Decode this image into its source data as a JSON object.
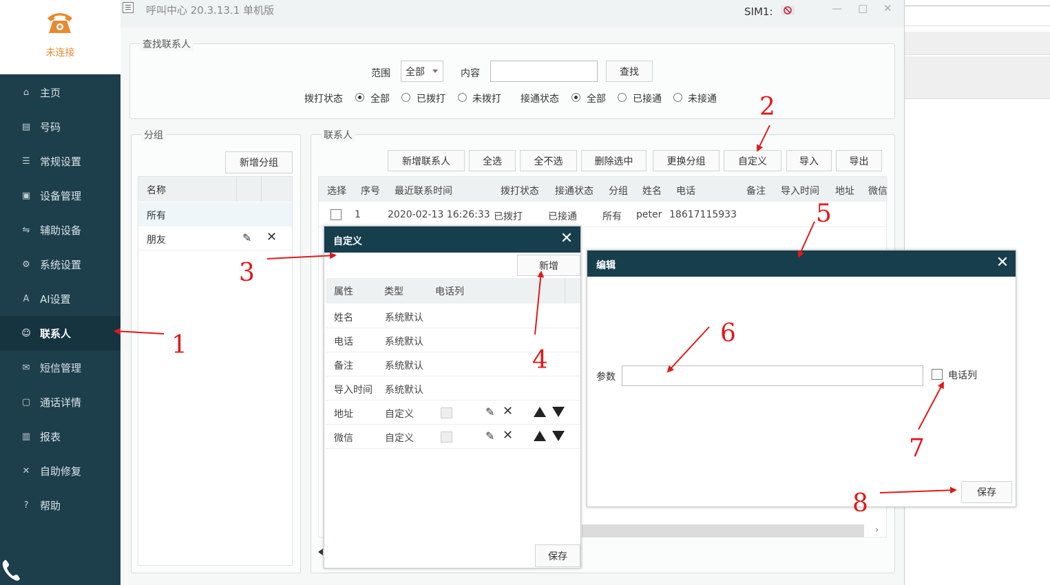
{
  "sidebar": {
    "status": "未连接",
    "items": [
      {
        "label": "主页",
        "icon": "home-icon"
      },
      {
        "label": "号码",
        "icon": "number-icon"
      },
      {
        "label": "常规设置",
        "icon": "sliders-icon"
      },
      {
        "label": "设备管理",
        "icon": "device-icon"
      },
      {
        "label": "辅助设备",
        "icon": "aux-device-icon"
      },
      {
        "label": "系统设置",
        "icon": "gear-icon"
      },
      {
        "label": "AI设置",
        "icon": "ai-icon"
      },
      {
        "label": "联系人",
        "icon": "contacts-icon"
      },
      {
        "label": "短信管理",
        "icon": "mail-icon"
      },
      {
        "label": "通话详情",
        "icon": "call-log-icon"
      },
      {
        "label": "报表",
        "icon": "chart-icon"
      },
      {
        "label": "自助修复",
        "icon": "tools-icon"
      },
      {
        "label": "帮助",
        "icon": "help-icon"
      }
    ],
    "active_index": 7
  },
  "window": {
    "title": "呼叫中心  20.3.13.1  单机版",
    "sim_label": "SIM1:",
    "controls": [
      "—",
      "□",
      "✕"
    ]
  },
  "search": {
    "section_title": "查找联系人",
    "scope_label": "范围",
    "scope_value": "全部",
    "content_label": "内容",
    "content_value": "",
    "search_button": "查找",
    "dial_status_label": "拨打状态",
    "dial_options": [
      "全部",
      "已拨打",
      "未拨打"
    ],
    "dial_selected": 0,
    "connect_status_label": "接通状态",
    "connect_options": [
      "全部",
      "已接通",
      "未接通"
    ],
    "connect_selected": 0
  },
  "groups": {
    "section_title": "分组",
    "add_button": "新增分组",
    "column_name": "名称",
    "items": [
      "所有",
      "朋友"
    ]
  },
  "contacts": {
    "section_title": "联系人",
    "toolbar": [
      "新增联系人",
      "全选",
      "全不选",
      "删除选中",
      "更换分组",
      "自定义",
      "导入",
      "导出"
    ],
    "columns": [
      "选择",
      "序号",
      "最近联系时间",
      "拨打状态",
      "接通状态",
      "分组",
      "姓名",
      "电话",
      "备注",
      "导入时间",
      "地址",
      "微信"
    ],
    "rows": [
      {
        "seq": "1",
        "time": "2020-02-13 16:26:33",
        "dial": "已拨打",
        "connect": "已接通",
        "group": "所有",
        "name": "peter",
        "phone": "18617115933"
      }
    ]
  },
  "custom_dialog": {
    "title": "自定义",
    "add_button": "新增",
    "columns": [
      "属性",
      "类型",
      "电话列"
    ],
    "rows": [
      {
        "attr": "姓名",
        "type": "系统默认",
        "editable": false
      },
      {
        "attr": "电话",
        "type": "系统默认",
        "editable": false
      },
      {
        "attr": "备注",
        "type": "系统默认",
        "editable": false
      },
      {
        "attr": "导入时间",
        "type": "系统默认",
        "editable": false
      },
      {
        "attr": "地址",
        "type": "自定义",
        "editable": true
      },
      {
        "attr": "微信",
        "type": "自定义",
        "editable": true
      }
    ],
    "save_button": "保存"
  },
  "edit_dialog": {
    "title": "编辑",
    "param_label": "参数",
    "param_value": "",
    "phone_column_label": "电话列",
    "save_button": "保存"
  },
  "annotations": [
    "1",
    "2",
    "3",
    "4",
    "5",
    "6",
    "7",
    "8"
  ],
  "colors": {
    "sidebar_bg": "#1d3e4b",
    "dialog_header": "#163e4d",
    "accent_orange": "#e98a2e",
    "annotation_red": "#e0191a"
  }
}
